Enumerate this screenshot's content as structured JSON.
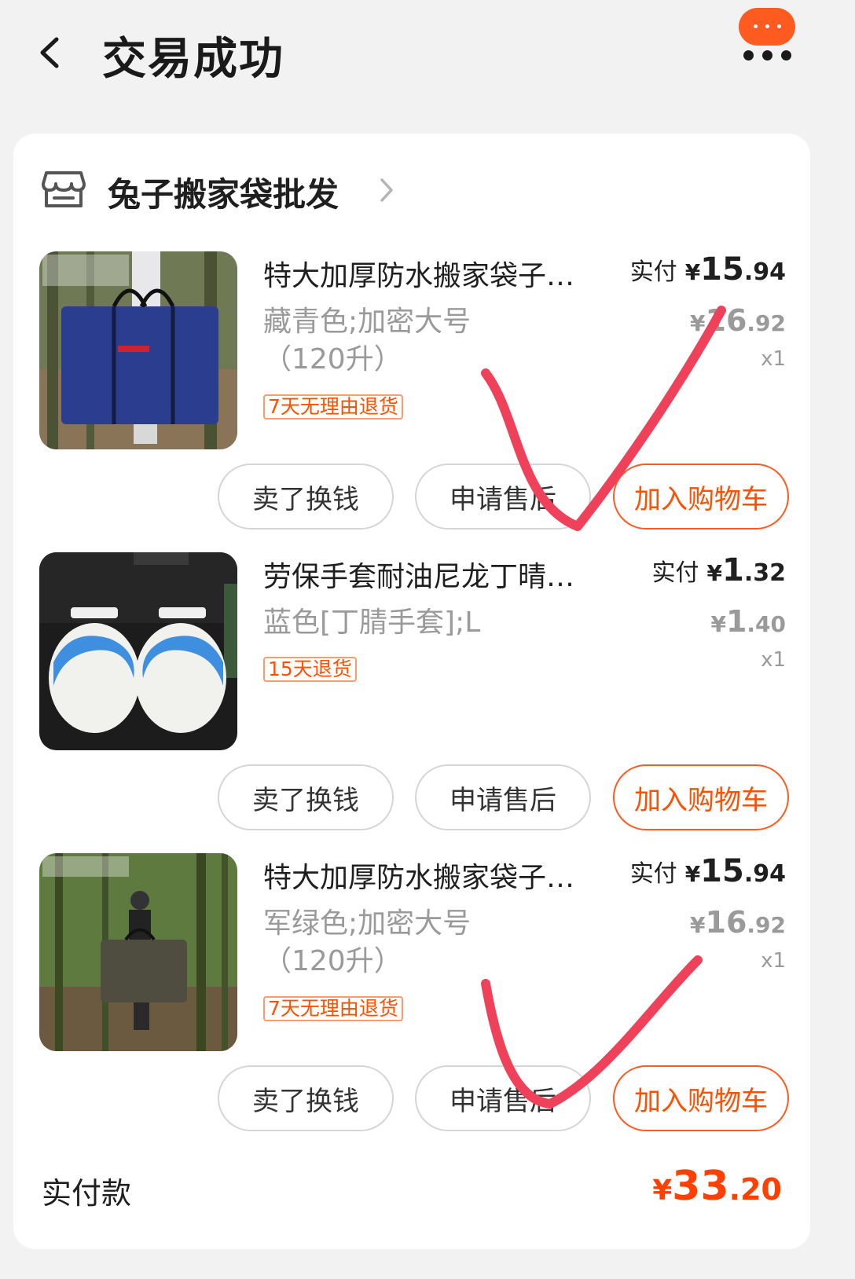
{
  "header": {
    "title": "交易成功",
    "back_icon": "chevron-left-icon",
    "more_icon": "more-icon",
    "message_icon": "message-bubble-icon",
    "accent_color": "#ff5000"
  },
  "shop": {
    "name": "兔子搬家袋批发",
    "icon": "store-icon"
  },
  "items": [
    {
      "name": "特大加厚防水搬家袋子…",
      "spec": "藏青色;加密大号（120升）",
      "badge": "7天无理由退货",
      "paid_label": "实付",
      "paid_currency": "¥",
      "paid_int": "15",
      "paid_dec": ".94",
      "orig_currency": "¥",
      "orig_int": "16",
      "orig_dec": ".92",
      "qty": "x1",
      "btn_sell": "卖了换钱",
      "btn_after": "申请售后",
      "btn_cart": "加入购物车",
      "image": "blue moving bag"
    },
    {
      "name": "劳保手套耐油尼龙丁晴…",
      "spec": "蓝色[丁腈手套];L",
      "badge": "15天退货",
      "paid_label": "实付",
      "paid_currency": "¥",
      "paid_int": "1",
      "paid_dec": ".32",
      "orig_currency": "¥",
      "orig_int": "1",
      "orig_dec": ".40",
      "qty": "x1",
      "btn_sell": "卖了换钱",
      "btn_after": "申请售后",
      "btn_cart": "加入购物车",
      "image": "blue work gloves"
    },
    {
      "name": "特大加厚防水搬家袋子…",
      "spec": "军绿色;加密大号（120升）",
      "badge": "7天无理由退货",
      "paid_label": "实付",
      "paid_currency": "¥",
      "paid_int": "15",
      "paid_dec": ".94",
      "orig_currency": "¥",
      "orig_int": "16",
      "orig_dec": ".92",
      "qty": "x1",
      "btn_sell": "卖了换钱",
      "btn_after": "申请售后",
      "btn_cart": "加入购物车",
      "image": "army green moving bag"
    }
  ],
  "summary": {
    "label": "实付款",
    "currency": "¥",
    "int": "33",
    "dec": ".20"
  },
  "overlay": {
    "checkmark_color": "#f0415a"
  }
}
